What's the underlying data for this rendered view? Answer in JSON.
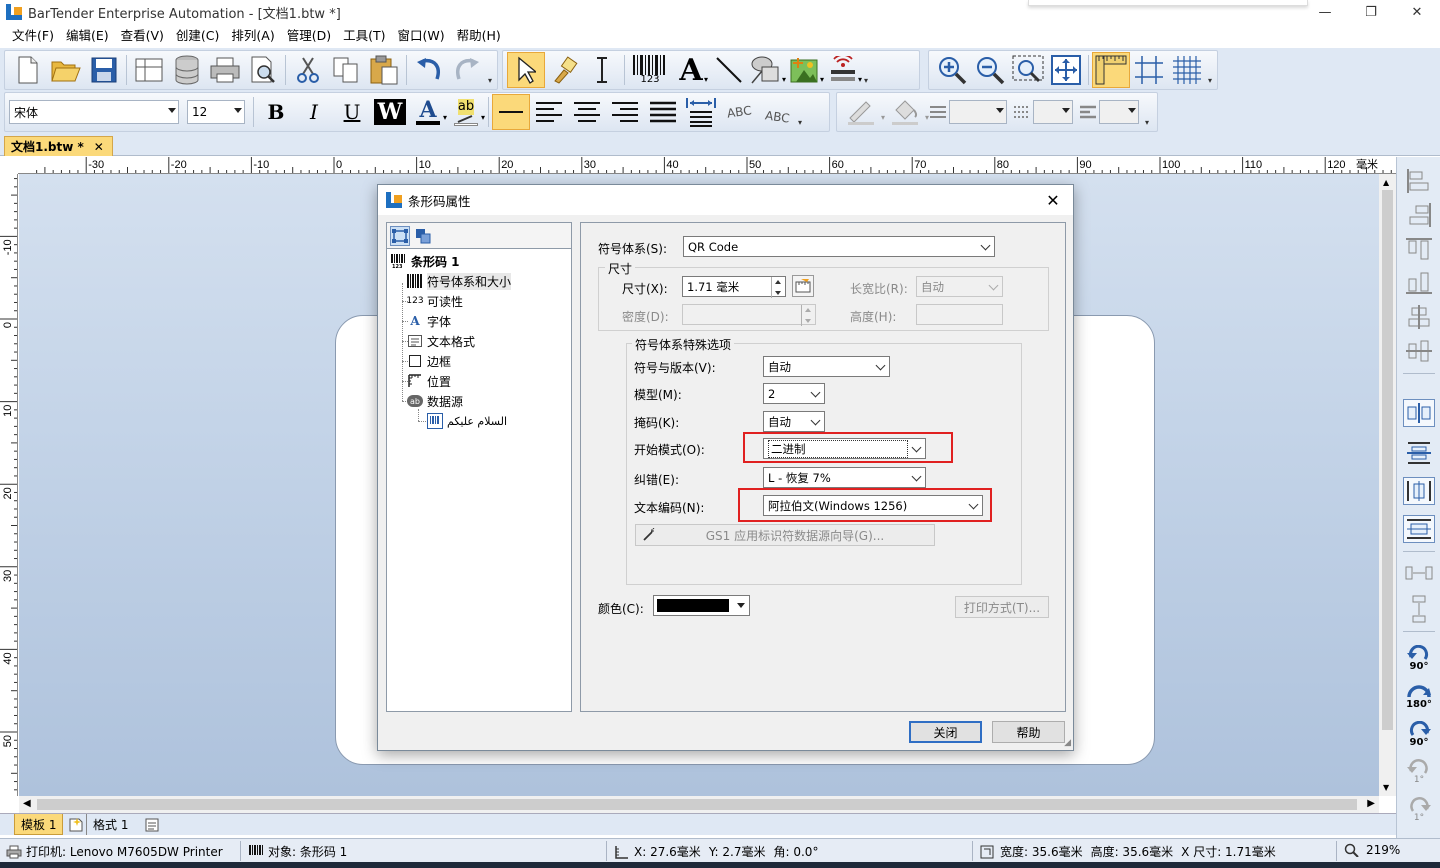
{
  "window": {
    "title": "BarTender Enterprise Automation - [文档1.btw *]",
    "minimize": "—",
    "restore": "❐",
    "close": "✕"
  },
  "menu": [
    "文件(F)",
    "编辑(E)",
    "查看(V)",
    "创建(C)",
    "排列(A)",
    "管理(D)",
    "工具(T)",
    "窗口(W)",
    "帮助(H)"
  ],
  "format_toolbar": {
    "font_name": "宋体",
    "font_size": "12",
    "bold": "B",
    "italic": "I",
    "underline": "U",
    "wordart": "W",
    "font_color_letter": "A",
    "highlight_letter": "ab",
    "abc1": "ABC",
    "abc2": "ABC"
  },
  "barcode_button_label": "123",
  "document_tab": {
    "label": "文档1.btw *",
    "close": "✕"
  },
  "ruler": {
    "unit": "毫米",
    "top_labels": [
      "-30",
      "-20",
      "-10",
      "0",
      "10",
      "20",
      "30",
      "40",
      "50",
      "60",
      "70",
      "80",
      "90",
      "100",
      "110",
      "120"
    ],
    "left_labels": [
      "-10",
      "0",
      "10",
      "20",
      "30",
      "40",
      "50"
    ]
  },
  "bottom_tabs": {
    "template": "模板 1",
    "format": "格式 1"
  },
  "status": {
    "printer": "打印机: Lenovo M7605DW Printer",
    "object": "对象: 条形码 1",
    "x": "X: 27.6毫米",
    "y": "Y: 2.7毫米",
    "angle": "角: 0.0°",
    "width": "宽度: 35.6毫米",
    "height": "高度: 35.6毫米",
    "xsize": "X 尺寸: 1.71毫米",
    "zoom": "219%"
  },
  "right_panel": {
    "rot90": "90°",
    "rot180": "180°",
    "rot90b": "90°",
    "rot1a": "1°",
    "rot1b": "1°"
  },
  "dialog": {
    "title": "条形码属性",
    "close": "✕",
    "tree": {
      "root": "条形码 1",
      "items": [
        "符号体系和大小",
        "可读性",
        "字体",
        "文本格式",
        "边框",
        "位置",
        "数据源"
      ],
      "child": "السلام عليكم",
      "readability_icon": "123",
      "font_icon": "A",
      "datasource_icon": "ab"
    },
    "symbology_label": "符号体系(S):",
    "symbology_value": "QR Code",
    "size_group": "尺寸",
    "size_label": "尺寸(X):",
    "size_value": "1.71 毫米",
    "aspect_label": "长宽比(R):",
    "aspect_value": "自动",
    "density_label": "密度(D):",
    "height_label": "高度(H):",
    "special_group": "符号体系特殊选项",
    "version_label": "符号与版本(V):",
    "version_value": "自动",
    "model_label": "模型(M):",
    "model_value": "2",
    "mask_label": "掩码(K):",
    "mask_value": "自动",
    "start_mode_label": "开始模式(O):",
    "start_mode_value": "二进制",
    "ecc_label": "纠错(E):",
    "ecc_value": "L - 恢复 7%",
    "encoding_label": "文本编码(N):",
    "encoding_value": "阿拉伯文(Windows 1256)",
    "gs1_button": "GS1 应用标识符数据源向导(G)...",
    "color_label": "颜色(C):",
    "color_value": "#000000",
    "print_method_button": "打印方式(T)...",
    "close_button": "关闭",
    "help_button": "帮助"
  },
  "colors": {
    "highlight_red": "#e02020",
    "selected_yellow": "#fbd97a",
    "accent_blue": "#2f6ec4"
  }
}
